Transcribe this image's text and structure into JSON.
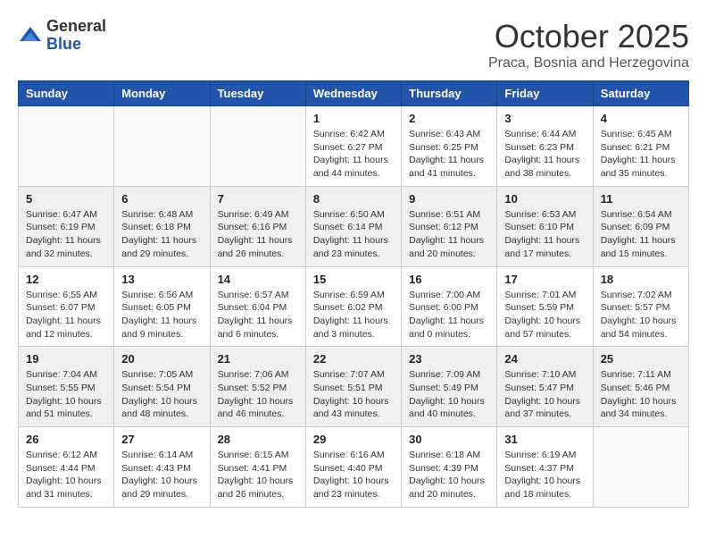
{
  "header": {
    "logo_general": "General",
    "logo_blue": "Blue",
    "month_title": "October 2025",
    "subtitle": "Praca, Bosnia and Herzegovina"
  },
  "days_of_week": [
    "Sunday",
    "Monday",
    "Tuesday",
    "Wednesday",
    "Thursday",
    "Friday",
    "Saturday"
  ],
  "weeks": [
    [
      {
        "num": "",
        "info": ""
      },
      {
        "num": "",
        "info": ""
      },
      {
        "num": "",
        "info": ""
      },
      {
        "num": "1",
        "info": "Sunrise: 6:42 AM\nSunset: 6:27 PM\nDaylight: 11 hours\nand 44 minutes."
      },
      {
        "num": "2",
        "info": "Sunrise: 6:43 AM\nSunset: 6:25 PM\nDaylight: 11 hours\nand 41 minutes."
      },
      {
        "num": "3",
        "info": "Sunrise: 6:44 AM\nSunset: 6:23 PM\nDaylight: 11 hours\nand 38 minutes."
      },
      {
        "num": "4",
        "info": "Sunrise: 6:45 AM\nSunset: 6:21 PM\nDaylight: 11 hours\nand 35 minutes."
      }
    ],
    [
      {
        "num": "5",
        "info": "Sunrise: 6:47 AM\nSunset: 6:19 PM\nDaylight: 11 hours\nand 32 minutes."
      },
      {
        "num": "6",
        "info": "Sunrise: 6:48 AM\nSunset: 6:18 PM\nDaylight: 11 hours\nand 29 minutes."
      },
      {
        "num": "7",
        "info": "Sunrise: 6:49 AM\nSunset: 6:16 PM\nDaylight: 11 hours\nand 26 minutes."
      },
      {
        "num": "8",
        "info": "Sunrise: 6:50 AM\nSunset: 6:14 PM\nDaylight: 11 hours\nand 23 minutes."
      },
      {
        "num": "9",
        "info": "Sunrise: 6:51 AM\nSunset: 6:12 PM\nDaylight: 11 hours\nand 20 minutes."
      },
      {
        "num": "10",
        "info": "Sunrise: 6:53 AM\nSunset: 6:10 PM\nDaylight: 11 hours\nand 17 minutes."
      },
      {
        "num": "11",
        "info": "Sunrise: 6:54 AM\nSunset: 6:09 PM\nDaylight: 11 hours\nand 15 minutes."
      }
    ],
    [
      {
        "num": "12",
        "info": "Sunrise: 6:55 AM\nSunset: 6:07 PM\nDaylight: 11 hours\nand 12 minutes."
      },
      {
        "num": "13",
        "info": "Sunrise: 6:56 AM\nSunset: 6:05 PM\nDaylight: 11 hours\nand 9 minutes."
      },
      {
        "num": "14",
        "info": "Sunrise: 6:57 AM\nSunset: 6:04 PM\nDaylight: 11 hours\nand 6 minutes."
      },
      {
        "num": "15",
        "info": "Sunrise: 6:59 AM\nSunset: 6:02 PM\nDaylight: 11 hours\nand 3 minutes."
      },
      {
        "num": "16",
        "info": "Sunrise: 7:00 AM\nSunset: 6:00 PM\nDaylight: 11 hours\nand 0 minutes."
      },
      {
        "num": "17",
        "info": "Sunrise: 7:01 AM\nSunset: 5:59 PM\nDaylight: 10 hours\nand 57 minutes."
      },
      {
        "num": "18",
        "info": "Sunrise: 7:02 AM\nSunset: 5:57 PM\nDaylight: 10 hours\nand 54 minutes."
      }
    ],
    [
      {
        "num": "19",
        "info": "Sunrise: 7:04 AM\nSunset: 5:55 PM\nDaylight: 10 hours\nand 51 minutes."
      },
      {
        "num": "20",
        "info": "Sunrise: 7:05 AM\nSunset: 5:54 PM\nDaylight: 10 hours\nand 48 minutes."
      },
      {
        "num": "21",
        "info": "Sunrise: 7:06 AM\nSunset: 5:52 PM\nDaylight: 10 hours\nand 46 minutes."
      },
      {
        "num": "22",
        "info": "Sunrise: 7:07 AM\nSunset: 5:51 PM\nDaylight: 10 hours\nand 43 minutes."
      },
      {
        "num": "23",
        "info": "Sunrise: 7:09 AM\nSunset: 5:49 PM\nDaylight: 10 hours\nand 40 minutes."
      },
      {
        "num": "24",
        "info": "Sunrise: 7:10 AM\nSunset: 5:47 PM\nDaylight: 10 hours\nand 37 minutes."
      },
      {
        "num": "25",
        "info": "Sunrise: 7:11 AM\nSunset: 5:46 PM\nDaylight: 10 hours\nand 34 minutes."
      }
    ],
    [
      {
        "num": "26",
        "info": "Sunrise: 6:12 AM\nSunset: 4:44 PM\nDaylight: 10 hours\nand 31 minutes."
      },
      {
        "num": "27",
        "info": "Sunrise: 6:14 AM\nSunset: 4:43 PM\nDaylight: 10 hours\nand 29 minutes."
      },
      {
        "num": "28",
        "info": "Sunrise: 6:15 AM\nSunset: 4:41 PM\nDaylight: 10 hours\nand 26 minutes."
      },
      {
        "num": "29",
        "info": "Sunrise: 6:16 AM\nSunset: 4:40 PM\nDaylight: 10 hours\nand 23 minutes."
      },
      {
        "num": "30",
        "info": "Sunrise: 6:18 AM\nSunset: 4:39 PM\nDaylight: 10 hours\nand 20 minutes."
      },
      {
        "num": "31",
        "info": "Sunrise: 6:19 AM\nSunset: 4:37 PM\nDaylight: 10 hours\nand 18 minutes."
      },
      {
        "num": "",
        "info": ""
      }
    ]
  ]
}
